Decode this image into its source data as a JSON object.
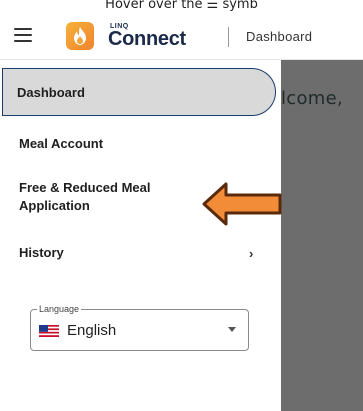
{
  "caption": "Hover over the ☰ symb",
  "header": {
    "brand_small": "LINQ",
    "brand": "Connect",
    "page_title": "Dashboard"
  },
  "main": {
    "welcome": "lcome,"
  },
  "sidebar": {
    "items": [
      {
        "label": "Dashboard",
        "active": true
      },
      {
        "label": "Meal Account"
      },
      {
        "label": "Free & Reduced Meal Application"
      },
      {
        "label": "History"
      }
    ],
    "history_chevron": "›"
  },
  "language": {
    "label": "Language",
    "value": "English"
  },
  "colors": {
    "arrow_fill": "#f28c38",
    "arrow_stroke": "#5a2a0a",
    "active_border": "#1a3d6d",
    "brand_navy": "#1b2a4a"
  },
  "icons": {
    "menu": "hamburger-icon",
    "brand": "flame-logo-icon",
    "flag": "us-flag-icon",
    "dropdown": "caret-down-icon"
  }
}
